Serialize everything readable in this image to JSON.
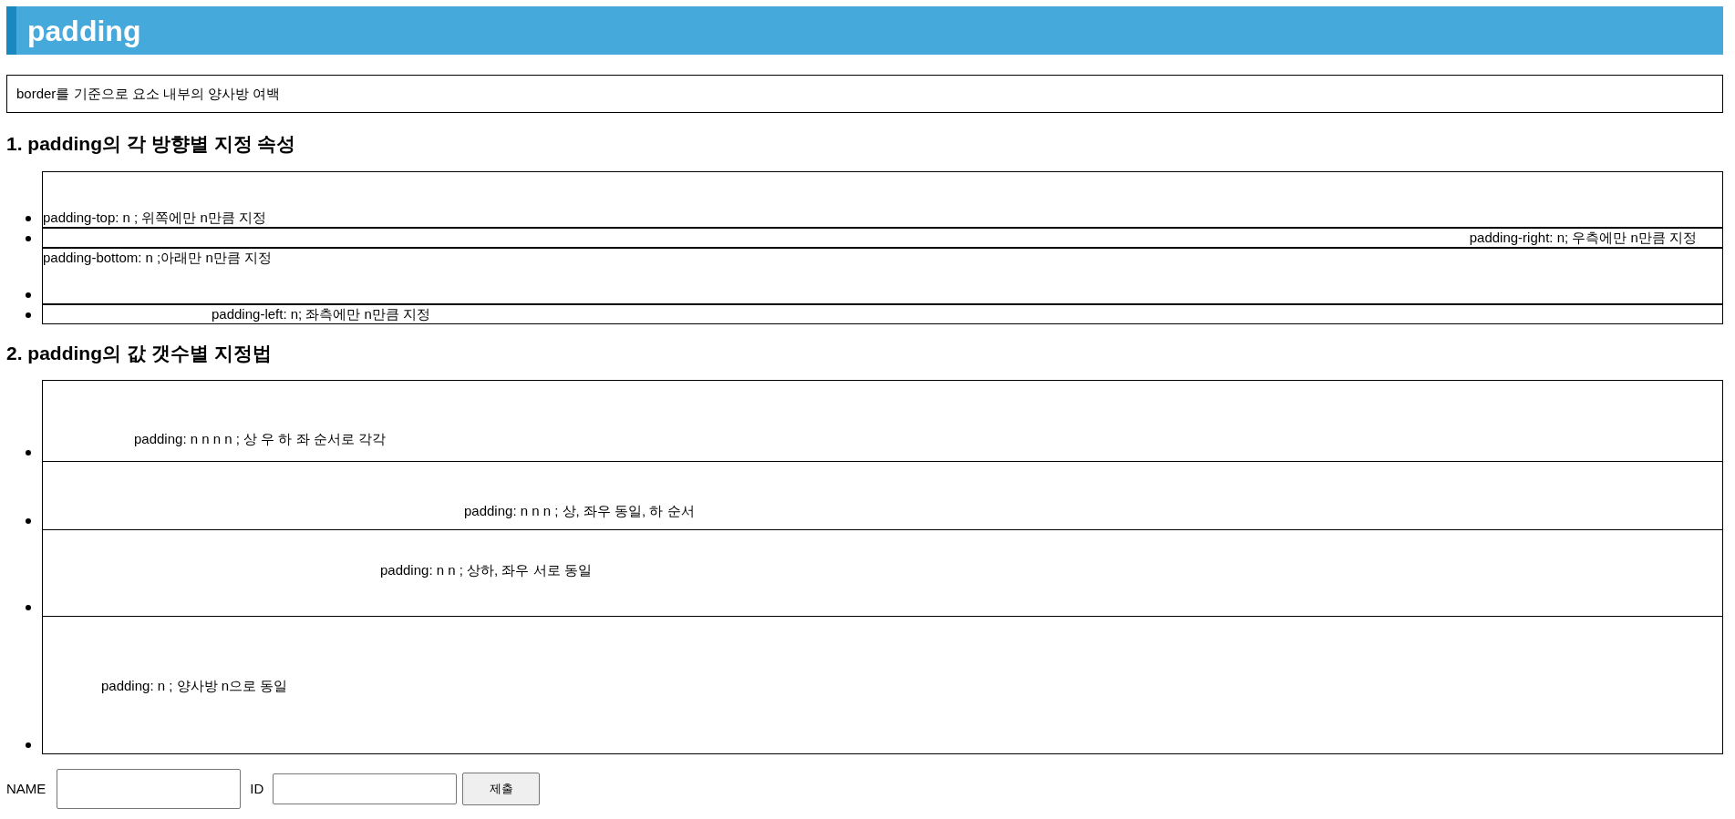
{
  "header": {
    "title": "padding"
  },
  "description": "border를 기준으로 요소 내부의 양사방 여백",
  "sections": [
    {
      "heading": "1. padding의 각 방향별 지정 속성",
      "items": [
        {
          "kind": "top",
          "text": "padding-top: n ; 위쪽에만 n만큼 지정"
        },
        {
          "kind": "right",
          "text": "padding-right: n; 우측에만 n만큼 지정"
        },
        {
          "kind": "bottom",
          "text": "padding-bottom: n ;아래만 n만큼 지정"
        },
        {
          "kind": "left",
          "text": "padding-left: n; 좌측에만 n만큼 지정"
        }
      ]
    },
    {
      "heading": "2. padding의 값 갯수별 지정법",
      "items": [
        {
          "kind": "four",
          "text": "padding: n n n n ; 상 우 하 좌 순서로 각각"
        },
        {
          "kind": "three",
          "text": "padding: n n n ; 상, 좌우 동일, 하 순서"
        },
        {
          "kind": "two",
          "text": "padding: n n ; 상하, 좌우 서로 동일"
        },
        {
          "kind": "one",
          "text": "padding: n ; 양사방 n으로 동일"
        }
      ]
    }
  ],
  "form": {
    "name_label": "NAME",
    "id_label": "ID",
    "submit": "제출"
  }
}
